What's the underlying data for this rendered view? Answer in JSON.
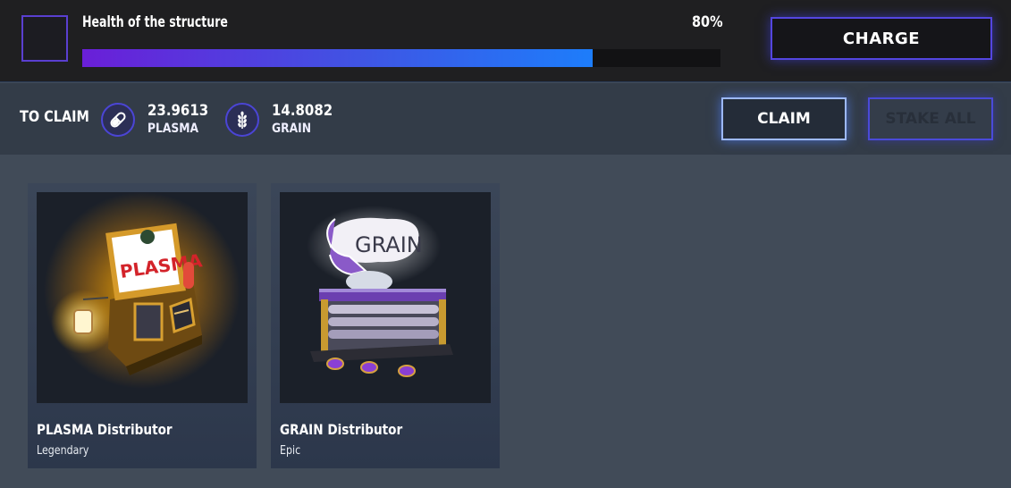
{
  "header": {
    "health_title": "Health of the structure",
    "health_percent_label": "80%",
    "health_fraction": 0.8,
    "charge_label": "CHARGE"
  },
  "claim": {
    "label": "TO CLAIM",
    "resources": [
      {
        "amount": "23.9613",
        "name": "PLASMA",
        "icon": "pill-icon"
      },
      {
        "amount": "14.8082",
        "name": "GRAIN",
        "icon": "wheat-icon"
      }
    ],
    "claim_label": "CLAIM",
    "stake_all_label": "STAKE ALL"
  },
  "cards": [
    {
      "name": "PLASMA Distributor",
      "rarity": "Legendary",
      "sign_text": "PLASMA"
    },
    {
      "name": "GRAIN Distributor",
      "rarity": "Epic",
      "sign_text": "GRAIN"
    }
  ],
  "colors": {
    "accent_purple": "#6a1fd8",
    "accent_blue": "#1d7dfb",
    "background": "#414b58"
  }
}
